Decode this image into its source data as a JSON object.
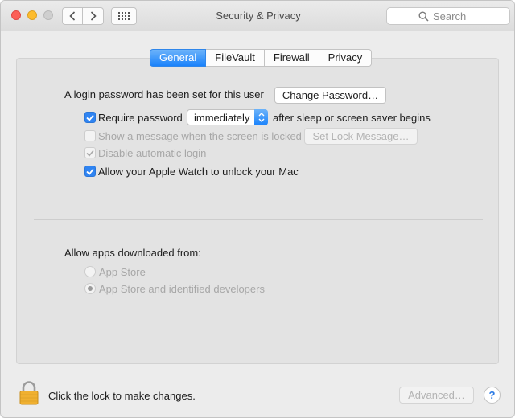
{
  "window": {
    "title": "Security & Privacy",
    "search_placeholder": "Search"
  },
  "tabs": [
    {
      "label": "General",
      "active": true
    },
    {
      "label": "FileVault",
      "active": false
    },
    {
      "label": "Firewall",
      "active": false
    },
    {
      "label": "Privacy",
      "active": false
    }
  ],
  "general": {
    "login_text": "A login password has been set for this user",
    "change_password_button": "Change Password…",
    "require_password": {
      "label": "Require password",
      "checked": true,
      "enabled": true
    },
    "require_password_delay": "immediately",
    "require_password_suffix": "after sleep or screen saver begins",
    "show_message": {
      "label": "Show a message when the screen is locked",
      "checked": false,
      "enabled": false
    },
    "set_lock_message_button": "Set Lock Message…",
    "disable_auto_login": {
      "label": "Disable automatic login",
      "checked": true,
      "enabled": false
    },
    "apple_watch_unlock": {
      "label": "Allow your Apple Watch to unlock your Mac",
      "checked": true,
      "enabled": true
    },
    "allow_apps_heading": "Allow apps downloaded from:",
    "app_source_options": [
      {
        "label": "App Store",
        "selected": false,
        "enabled": false
      },
      {
        "label": "App Store and identified developers",
        "selected": true,
        "enabled": false
      }
    ]
  },
  "footer": {
    "lock_text": "Click the lock to make changes.",
    "advanced_button": "Advanced…",
    "help_label": "?"
  },
  "colors": {
    "accent": "#1a82fb",
    "window_bg": "#ececec",
    "panel_bg": "#e3e3e3"
  }
}
